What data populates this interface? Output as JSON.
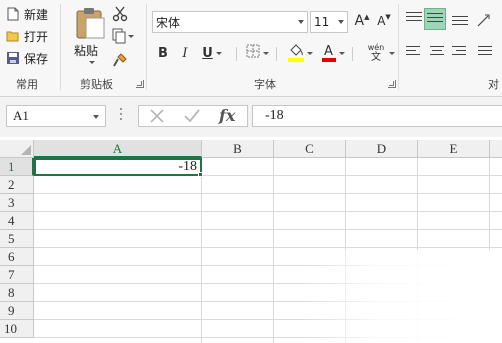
{
  "ribbon": {
    "clipboard_group": {
      "new_label": "新建",
      "open_label": "打开",
      "save_label": "保存",
      "common_label": "常用",
      "paste_label": "粘贴",
      "group_label": "剪贴板"
    },
    "font_group": {
      "font_name": "宋体",
      "font_size": "11",
      "bold": "B",
      "italic": "I",
      "underline": "U",
      "font_color_letter": "A",
      "pinyin": "wén",
      "pinyin_char": "文",
      "grow_font": "A",
      "shrink_font": "A",
      "group_label": "字体"
    },
    "align_group": {
      "group_label_partial": "对"
    },
    "colors": {
      "highlight_yellow": "#ffff00",
      "font_red": "#e60000",
      "accent_green": "#217346",
      "active_align_bg": "#9fd5b7"
    }
  },
  "formula_bar": {
    "name_box": "A1",
    "fx_label": "fx",
    "formula_value": "-18"
  },
  "grid": {
    "columns": [
      "A",
      "B",
      "C",
      "D",
      "E"
    ],
    "rows": [
      "1",
      "2",
      "3",
      "4",
      "5",
      "6",
      "7",
      "8",
      "9",
      "10"
    ],
    "active_cell_value": "-18"
  }
}
